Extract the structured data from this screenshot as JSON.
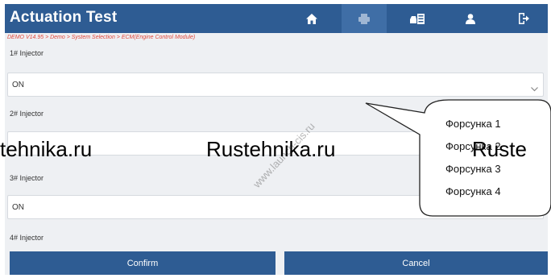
{
  "header": {
    "title": "Actuation Test",
    "nav": [
      {
        "icon": "home-icon"
      },
      {
        "icon": "printer-icon"
      },
      {
        "icon": "vehicle-data-icon"
      },
      {
        "icon": "user-icon"
      },
      {
        "icon": "exit-icon"
      }
    ]
  },
  "breadcrumb": "DEMO V14.95 > Demo > System Selection > ECM(Engine Control Module)",
  "injectors": [
    {
      "label": "1# Injector",
      "value": "ON"
    },
    {
      "label": "2# Injector",
      "value": ""
    },
    {
      "label": "3# Injector",
      "value": "ON"
    },
    {
      "label": "4# Injector",
      "value": ""
    }
  ],
  "buttons": {
    "confirm": "Confirm",
    "cancel": "Cancel"
  },
  "callout": {
    "items": [
      "Форсунка 1",
      "Форсунка 2",
      "Форсунка 3",
      "Форсунка 4"
    ]
  },
  "watermarks": {
    "left": "tehnika.ru",
    "center": "Rustehnika.ru",
    "right": "Ruste",
    "diagonal": "www.launch-cis.ru"
  },
  "colors": {
    "header": "#2e5c93",
    "breadcrumb": "#e0473b",
    "button": "#2e5c93"
  }
}
